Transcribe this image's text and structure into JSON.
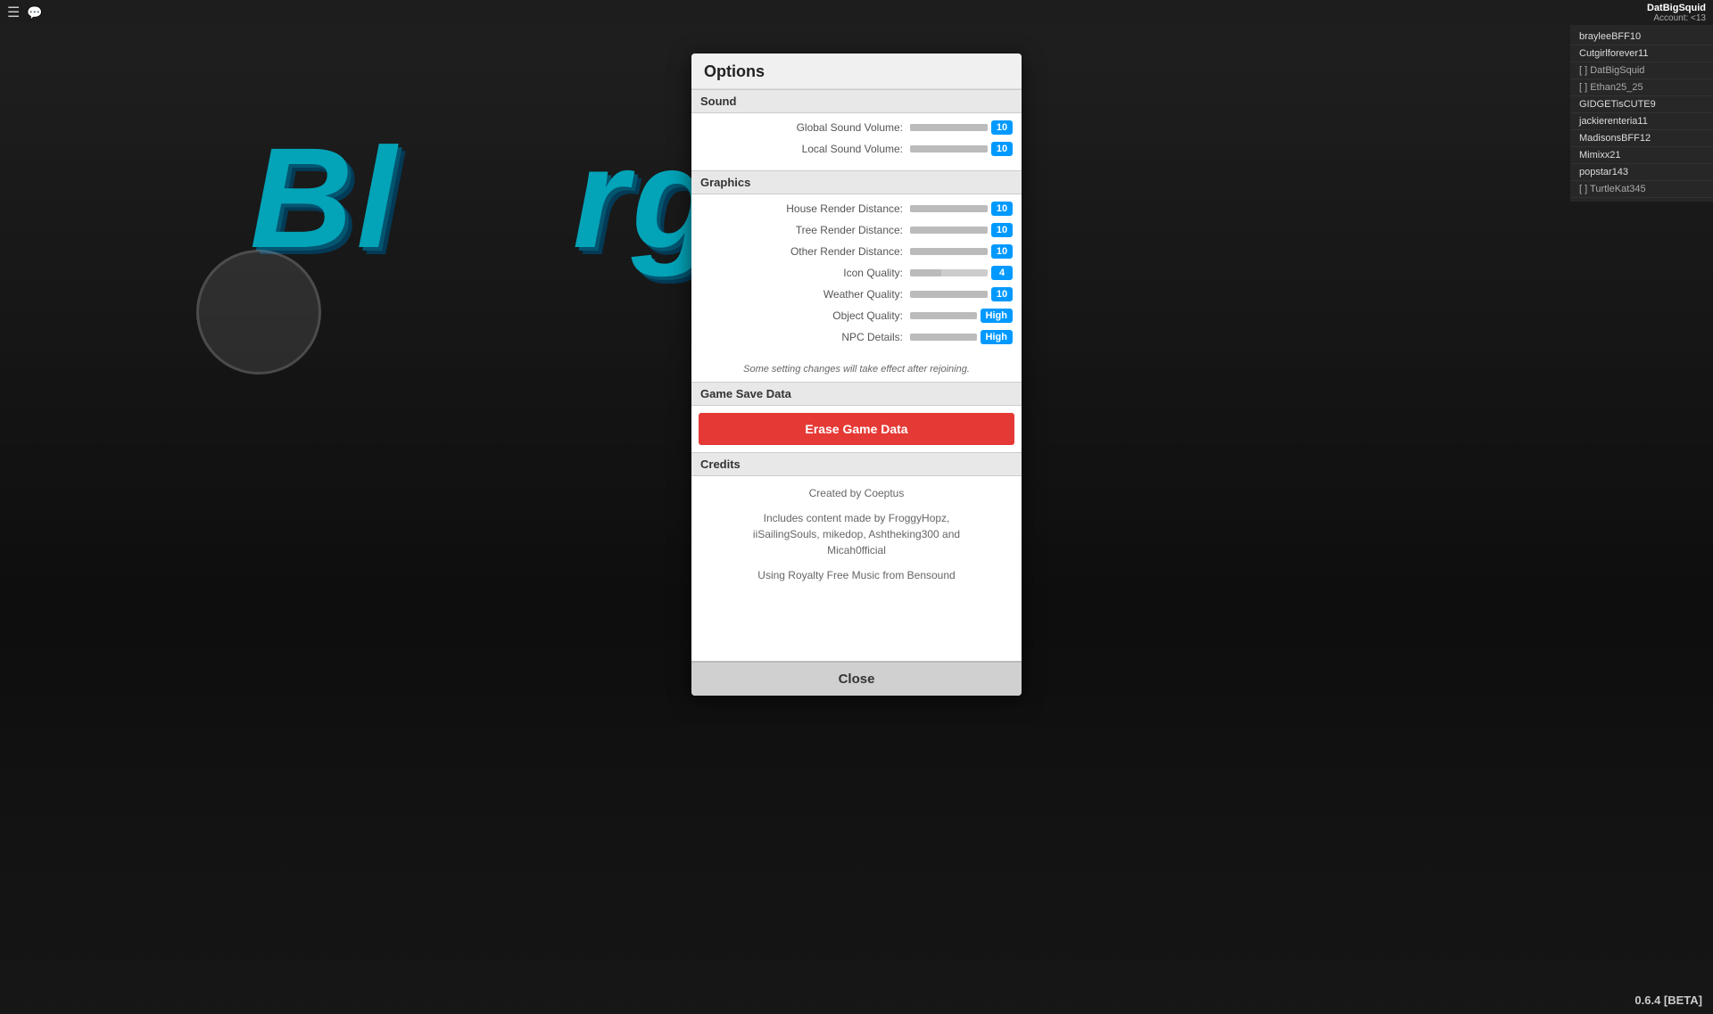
{
  "topbar": {
    "username": "DatBigSquid",
    "account_label": "Account: <13"
  },
  "players": [
    {
      "name": "brayleeBFF10",
      "type": "normal"
    },
    {
      "name": "Cutgirlforever11",
      "type": "normal"
    },
    {
      "name": "[ ] DatBigSquid",
      "type": "bracket"
    },
    {
      "name": "[ ] Ethan25_25",
      "type": "bracket"
    },
    {
      "name": "GIDGETisCUTE9",
      "type": "normal"
    },
    {
      "name": "jackierenteria11",
      "type": "normal"
    },
    {
      "name": "MadisonsBFF12",
      "type": "normal"
    },
    {
      "name": "Mimixx21",
      "type": "normal"
    },
    {
      "name": "popstar143",
      "type": "normal"
    },
    {
      "name": "[ ] TurtleKat345",
      "type": "bracket"
    }
  ],
  "version": "0.6.4 [BETA]",
  "modal": {
    "title": "Options",
    "sections": {
      "sound": {
        "header": "Sound",
        "settings": [
          {
            "label": "Global Sound Volume:",
            "value": "10"
          },
          {
            "label": "Local Sound Volume:",
            "value": "10"
          }
        ]
      },
      "graphics": {
        "header": "Graphics",
        "settings": [
          {
            "label": "House Render Distance:",
            "value": "10"
          },
          {
            "label": "Tree Render Distance:",
            "value": "10"
          },
          {
            "label": "Other Render Distance:",
            "value": "10"
          },
          {
            "label": "Icon Quality:",
            "value": "4"
          },
          {
            "label": "Weather Quality:",
            "value": "10"
          },
          {
            "label": "Object Quality:",
            "value": "High"
          },
          {
            "label": "NPC Details:",
            "value": "High"
          }
        ]
      }
    },
    "notice": "Some setting changes will take effect after rejoining.",
    "game_save_header": "Game Save Data",
    "erase_button": "Erase Game Data",
    "credits_header": "Credits",
    "credits_lines": [
      "Created by Coeptus",
      "Includes content made by FroggyHopz,\niiSailingSouls, mikedop, Ashtheking300 and\nMicah0fficial",
      "Using Royalty Free Music from Bensound"
    ],
    "close_button": "Close"
  }
}
